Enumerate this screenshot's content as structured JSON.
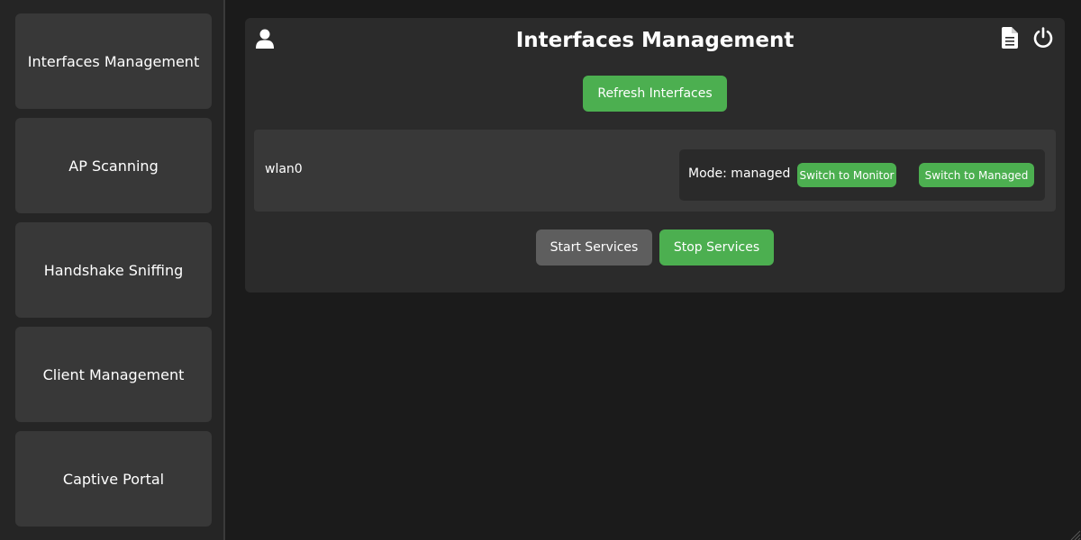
{
  "sidebar": {
    "items": [
      {
        "label": "Interfaces Management"
      },
      {
        "label": "AP Scanning"
      },
      {
        "label": "Handshake Sniffing"
      },
      {
        "label": "Client Management"
      },
      {
        "label": "Captive Portal"
      }
    ]
  },
  "header": {
    "title": "Interfaces Management",
    "icons": {
      "user": "user-icon",
      "logs": "document-icon",
      "power": "power-icon"
    }
  },
  "actions": {
    "refresh_label": "Refresh Interfaces",
    "start_label": "Start Services",
    "stop_label": "Stop Services"
  },
  "interfaces": [
    {
      "name": "wlan0",
      "mode_text": "Mode: managed",
      "monitor_label": "Switch to Monitor",
      "managed_label": "Switch to Managed"
    }
  ],
  "colors": {
    "accent_green": "#4caf50",
    "neutral_button": "#5e5e5e",
    "panel_bg": "#2b2b2b",
    "sidebar_bg": "#252525",
    "page_bg": "#1b1b1b"
  }
}
